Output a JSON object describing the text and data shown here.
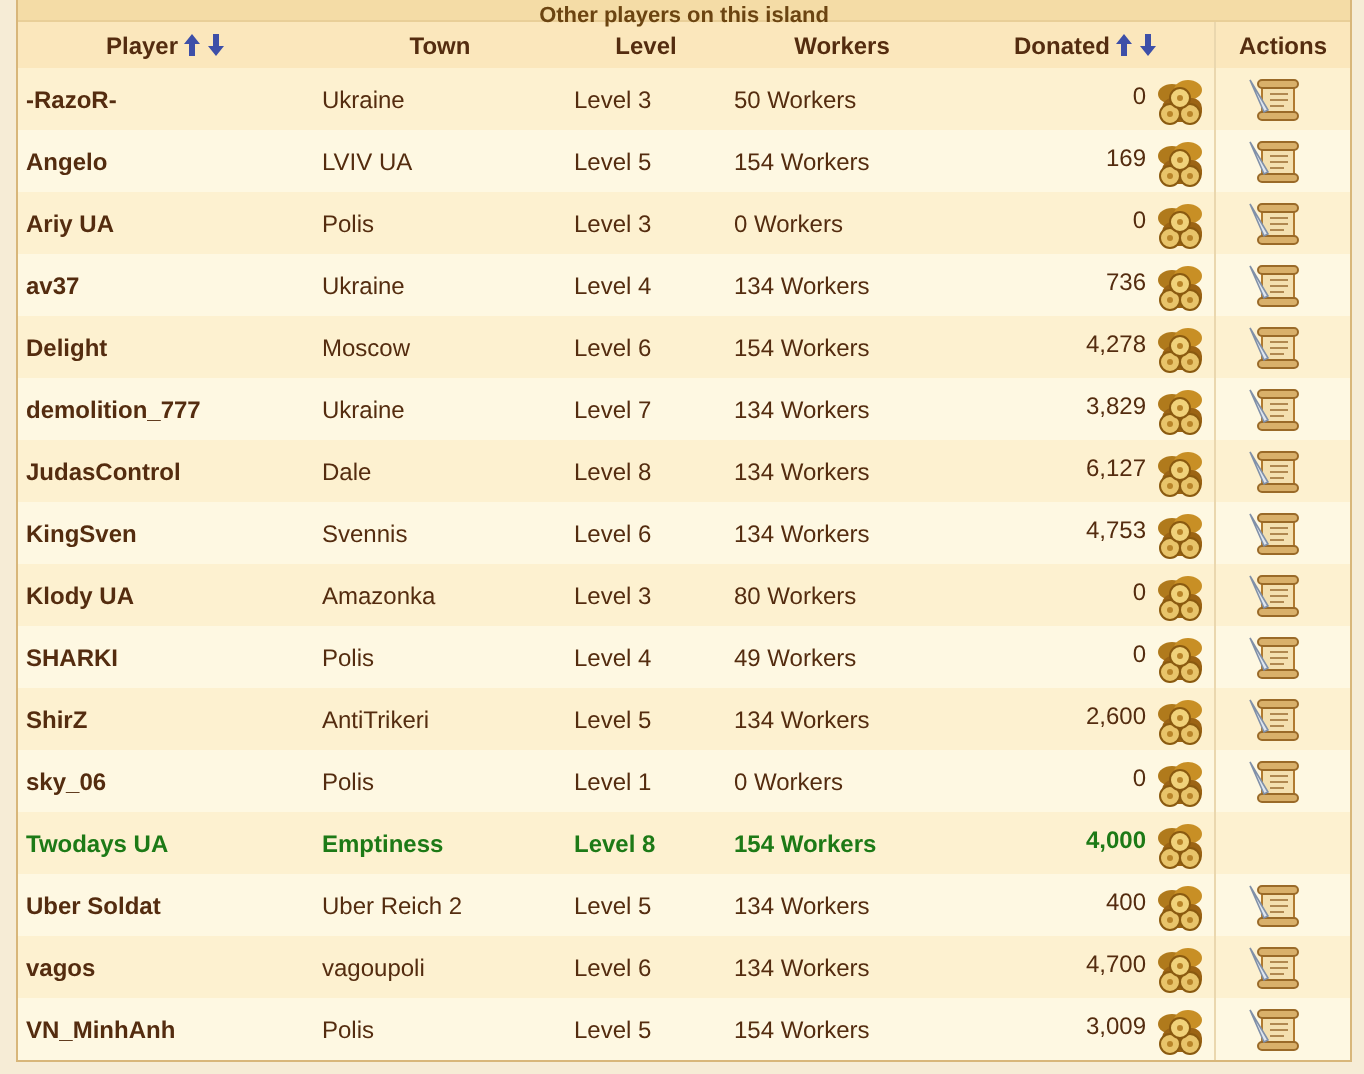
{
  "title": "Other players on this island",
  "table": {
    "columns": [
      {
        "label": "Player",
        "sortable": true
      },
      {
        "label": "Town",
        "sortable": false
      },
      {
        "label": "Level",
        "sortable": false
      },
      {
        "label": "Workers",
        "sortable": false
      },
      {
        "label": "Donated",
        "sortable": true
      },
      {
        "label": "Actions",
        "sortable": false
      }
    ],
    "rows": [
      {
        "player": "-RazoR-",
        "town": "Ukraine",
        "level": "Level 3",
        "workers": "50 Workers",
        "donated": "0",
        "own": false,
        "message_action": true
      },
      {
        "player": "Angelo",
        "town": "LVIV UA",
        "level": "Level 5",
        "workers": "154 Workers",
        "donated": "169",
        "own": false,
        "message_action": true
      },
      {
        "player": "Ariy UA",
        "town": "Polis",
        "level": "Level 3",
        "workers": "0 Workers",
        "donated": "0",
        "own": false,
        "message_action": true
      },
      {
        "player": "av37",
        "town": "Ukraine",
        "level": "Level 4",
        "workers": "134 Workers",
        "donated": "736",
        "own": false,
        "message_action": true
      },
      {
        "player": "Delight",
        "town": "Moscow",
        "level": "Level 6",
        "workers": "154 Workers",
        "donated": "4,278",
        "own": false,
        "message_action": true
      },
      {
        "player": "demolition_777",
        "town": "Ukraine",
        "level": "Level 7",
        "workers": "134 Workers",
        "donated": "3,829",
        "own": false,
        "message_action": true
      },
      {
        "player": "JudasControl",
        "town": "Dale",
        "level": "Level 8",
        "workers": "134 Workers",
        "donated": "6,127",
        "own": false,
        "message_action": true
      },
      {
        "player": "KingSven",
        "town": "Svennis",
        "level": "Level 6",
        "workers": "134 Workers",
        "donated": "4,753",
        "own": false,
        "message_action": true
      },
      {
        "player": "Klody UA",
        "town": "Amazonka",
        "level": "Level 3",
        "workers": "80 Workers",
        "donated": "0",
        "own": false,
        "message_action": true
      },
      {
        "player": "SHARKI",
        "town": "Polis",
        "level": "Level 4",
        "workers": "49 Workers",
        "donated": "0",
        "own": false,
        "message_action": true
      },
      {
        "player": "ShirZ",
        "town": "AntiTrikeri",
        "level": "Level 5",
        "workers": "134 Workers",
        "donated": "2,600",
        "own": false,
        "message_action": true
      },
      {
        "player": "sky_06",
        "town": "Polis",
        "level": "Level 1",
        "workers": "0 Workers",
        "donated": "0",
        "own": false,
        "message_action": true
      },
      {
        "player": "Twodays UA",
        "town": "Emptiness",
        "level": "Level 8",
        "workers": "154 Workers",
        "donated": "4,000",
        "own": true,
        "message_action": false
      },
      {
        "player": "Uber Soldat",
        "town": "Uber Reich 2",
        "level": "Level 5",
        "workers": "134 Workers",
        "donated": "400",
        "own": false,
        "message_action": true
      },
      {
        "player": "vagos",
        "town": "vagoupoli",
        "level": "Level 6",
        "workers": "134 Workers",
        "donated": "4,700",
        "own": false,
        "message_action": true
      },
      {
        "player": "VN_MinhAnh",
        "town": "Polis",
        "level": "Level 5",
        "workers": "154 Workers",
        "donated": "3,009",
        "own": false,
        "message_action": true
      }
    ]
  }
}
